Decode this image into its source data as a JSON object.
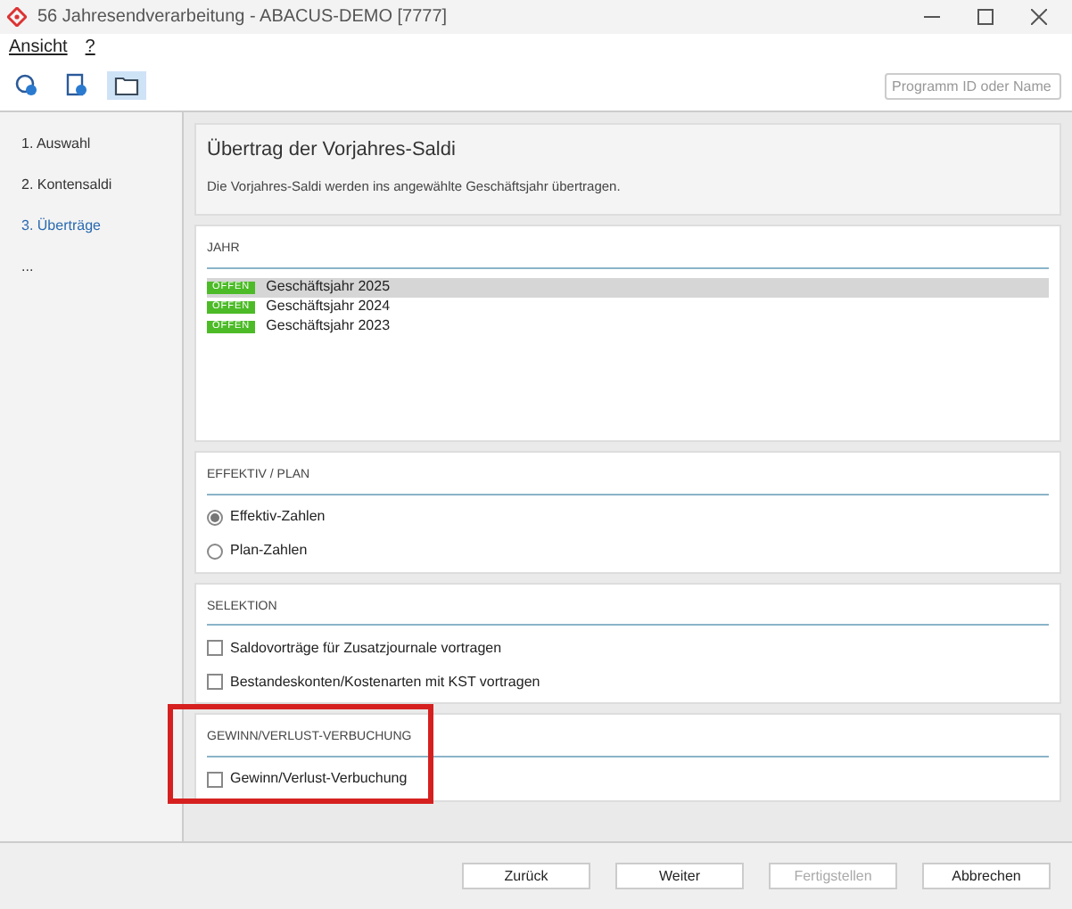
{
  "window": {
    "title": "56 Jahresendverarbeitung - ABACUS-DEMO [7777]"
  },
  "menu": [
    "Ansicht",
    "?"
  ],
  "toolbar": [
    {
      "kind": "search",
      "selected": false
    },
    {
      "kind": "document",
      "selected": false
    },
    {
      "kind": "folder",
      "selected": true
    }
  ],
  "search": {
    "placeholder": "Programm ID oder Name"
  },
  "steps": [
    {
      "label": "1. Auswahl",
      "selected": false
    },
    {
      "label": "2. Kontensaldi",
      "selected": false
    },
    {
      "label": "3. Überträge",
      "selected": true
    },
    {
      "label": "...",
      "selected": false
    }
  ],
  "header": {
    "title": "Übertrag der Vorjahres-Saldi",
    "description": "Die Vorjahres-Saldi werden ins angewählte Geschäftsjahr übertragen."
  },
  "sections": [
    {
      "kind": "list",
      "title": "JAHR",
      "highlighted": false,
      "items": [
        {
          "badge": "OFFEN",
          "label": "Geschäftsjahr 2025",
          "selected": true
        },
        {
          "badge": "OFFEN",
          "label": "Geschäftsjahr 2024",
          "selected": false
        },
        {
          "badge": "OFFEN",
          "label": "Geschäftsjahr 2023",
          "selected": false
        }
      ]
    },
    {
      "kind": "radio",
      "title": "EFFEKTIV / PLAN",
      "highlighted": false,
      "items": [
        {
          "label": "Effektiv-Zahlen",
          "selected": true
        },
        {
          "label": "Plan-Zahlen",
          "selected": false
        }
      ]
    },
    {
      "kind": "checkbox",
      "title": "SELEKTION",
      "highlighted": false,
      "items": [
        {
          "label": "Saldovorträge für Zusatzjournale vortragen",
          "checked": false
        },
        {
          "label": "Bestandeskonten/Kostenarten mit KST vortragen",
          "checked": false
        }
      ]
    },
    {
      "kind": "checkbox",
      "title": "GEWINN/VERLUST-VERBUCHUNG",
      "highlighted": true,
      "items": [
        {
          "label": "Gewinn/Verlust-Verbuchung",
          "checked": false
        }
      ]
    }
  ],
  "buttons": [
    {
      "label": "Zurück",
      "disabled": false
    },
    {
      "label": "Weiter",
      "disabled": false
    },
    {
      "label": "Fertigstellen",
      "disabled": true
    },
    {
      "label": "Abbrechen",
      "disabled": false
    }
  ]
}
